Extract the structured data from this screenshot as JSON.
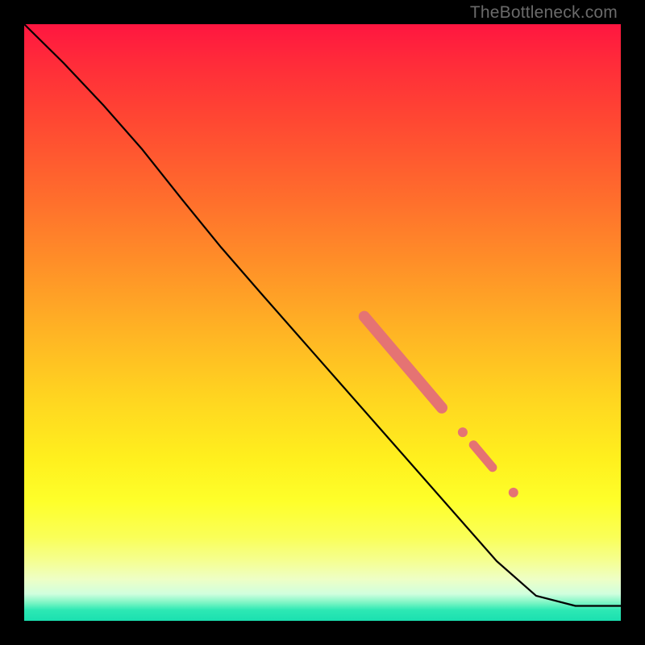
{
  "watermark": "TheBottleneck.com",
  "chart_data": {
    "type": "line",
    "title": "",
    "xlabel": "",
    "ylabel": "",
    "xlim": [
      0,
      100
    ],
    "ylim": [
      0,
      100
    ],
    "grid": false,
    "legend": false,
    "series": [
      {
        "name": "curve",
        "color": "#000000",
        "x": [
          0,
          6.6,
          13.2,
          19.8,
          26.4,
          33.0,
          39.6,
          46.2,
          52.8,
          59.4,
          66.0,
          72.6,
          79.2,
          85.8,
          92.4,
          95.0,
          100.0
        ],
        "values": [
          100,
          93.5,
          86.5,
          79.0,
          70.7,
          62.6,
          55.0,
          47.5,
          40.0,
          32.5,
          25.0,
          17.5,
          10.0,
          4.2,
          2.5,
          2.5,
          2.5
        ]
      }
    ],
    "highlights": [
      {
        "type": "thick-segment",
        "x0": 57,
        "y0": 51,
        "x1": 70,
        "y1": 35.7,
        "color": "#e57373",
        "width": 14
      },
      {
        "type": "dot",
        "x": 73.5,
        "y": 31.6,
        "r": 6,
        "color": "#e57373"
      },
      {
        "type": "thick-segment",
        "x0": 75.3,
        "y0": 29.5,
        "x1": 78.5,
        "y1": 25.7,
        "color": "#e57373",
        "width": 11
      },
      {
        "type": "dot",
        "x": 82,
        "y": 21.5,
        "r": 6,
        "color": "#e57373"
      }
    ]
  }
}
